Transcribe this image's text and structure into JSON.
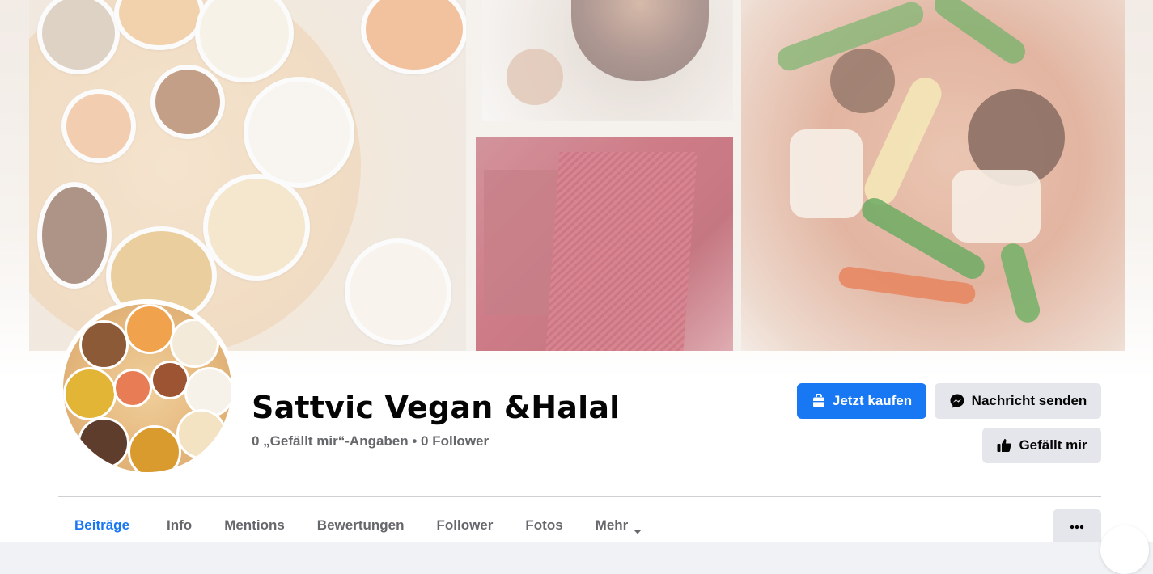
{
  "page": {
    "name": "Sattvic Vegan &Halal",
    "stats": "0 „Gefällt mir“-Angaben • 0 Follower"
  },
  "actions": {
    "buy_label": "Jetzt kaufen",
    "message_label": "Nachricht senden",
    "like_label": "Gefällt mir"
  },
  "tabs": [
    {
      "label": "Beiträge",
      "active": true
    },
    {
      "label": "Info"
    },
    {
      "label": "Mentions"
    },
    {
      "label": "Bewertungen"
    },
    {
      "label": "Follower"
    },
    {
      "label": "Fotos"
    },
    {
      "label": "Mehr"
    }
  ],
  "icons": {
    "buy": "shopping-bag-icon",
    "message": "messenger-icon",
    "like": "thumbs-up-icon",
    "more_dropdown": "caret-down-icon",
    "overflow": "more-horizontal-icon"
  },
  "colors": {
    "accent": "#1877f2",
    "secondary_button": "#e4e6eb",
    "text_primary": "#050505",
    "text_secondary": "#65676b"
  }
}
